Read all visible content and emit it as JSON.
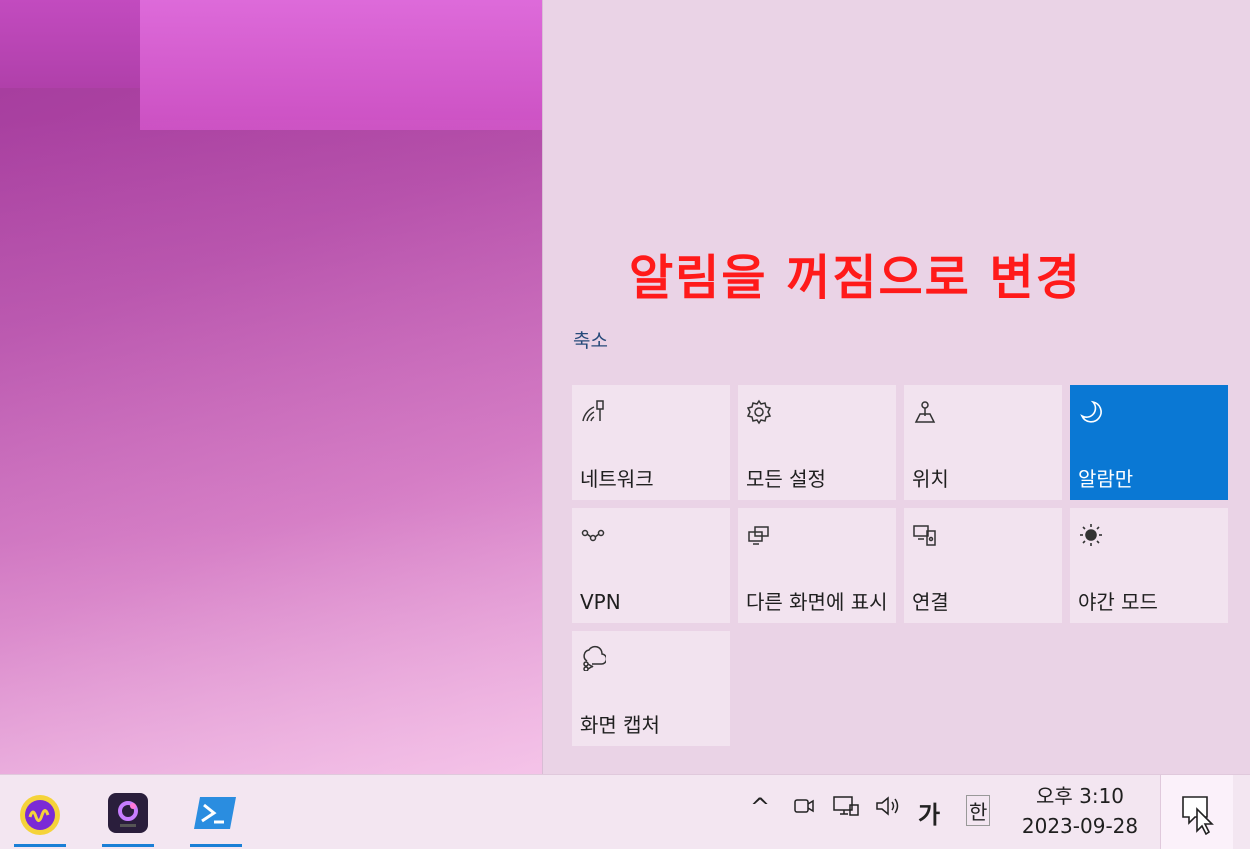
{
  "annotation": "알림을 꺼짐으로 변경",
  "action_center": {
    "collapse_label": "축소",
    "tiles": [
      {
        "label": "네트워크",
        "icon": "network-icon",
        "active": false
      },
      {
        "label": "모든 설정",
        "icon": "settings-gear-icon",
        "active": false
      },
      {
        "label": "위치",
        "icon": "location-icon",
        "active": false
      },
      {
        "label": "알람만",
        "icon": "moon-icon",
        "active": true
      },
      {
        "label": "VPN",
        "icon": "vpn-icon",
        "active": false
      },
      {
        "label": "다른 화면에 표시",
        "icon": "project-icon",
        "active": false
      },
      {
        "label": "연결",
        "icon": "connect-icon",
        "active": false
      },
      {
        "label": "야간 모드",
        "icon": "brightness-icon",
        "active": false
      },
      {
        "label": "화면 캡처",
        "icon": "screen-snip-icon",
        "active": false
      }
    ],
    "active_color": "#0a78d4"
  },
  "taskbar": {
    "apps": [
      {
        "name": "waveform-app-icon"
      },
      {
        "name": "dark-app-icon"
      },
      {
        "name": "powershell-icon"
      }
    ],
    "tray": {
      "chevron": "^",
      "ime_language": "가",
      "ime_mode": "한"
    },
    "clock": {
      "time": "오후 3:10",
      "date": "2023-09-28"
    }
  }
}
